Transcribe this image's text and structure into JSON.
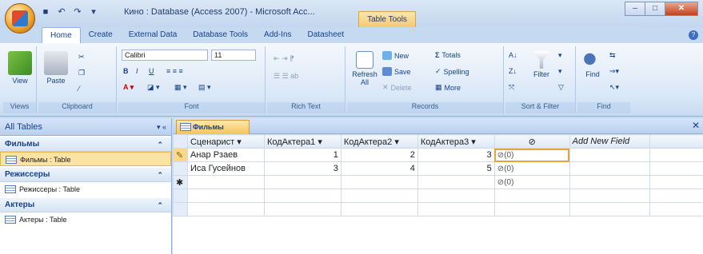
{
  "title_bar": {
    "window_title": "Кино : Database (Access 2007) - Microsoft Acc...",
    "context_tab": "Table Tools"
  },
  "tabs": [
    "Home",
    "Create",
    "External Data",
    "Database Tools",
    "Add-Ins",
    "Datasheet"
  ],
  "ribbon": {
    "views": {
      "view_label": "View",
      "group": "Views"
    },
    "clipboard": {
      "paste_label": "Paste",
      "group": "Clipboard"
    },
    "font": {
      "font_name": "Calibri",
      "font_size": "11",
      "group": "Font"
    },
    "rich_text": {
      "group": "Rich Text"
    },
    "records": {
      "refresh_label": "Refresh All",
      "new_label": "New",
      "save_label": "Save",
      "delete_label": "Delete",
      "totals_label": "Totals",
      "spelling_label": "Spelling",
      "more_label": "More",
      "group": "Records"
    },
    "sort_filter": {
      "filter_label": "Filter",
      "group": "Sort & Filter"
    },
    "find": {
      "find_label": "Find",
      "group": "Find"
    }
  },
  "nav_pane": {
    "header": "All Tables",
    "sections": [
      {
        "title": "Фильмы",
        "item": "Фильмы : Table"
      },
      {
        "title": "Режиссеры",
        "item": "Режиссеры : Table"
      },
      {
        "title": "Актеры",
        "item": "Актеры : Table"
      }
    ]
  },
  "document": {
    "tab_label": "Фильмы",
    "columns": [
      "Сценарист",
      "КодАктера1",
      "КодАктера2",
      "КодАктера3",
      "",
      "Add New Field"
    ],
    "rows": [
      {
        "writer": "Анар Рзаев",
        "a1": "1",
        "a2": "2",
        "a3": "3",
        "att": "(0)"
      },
      {
        "writer": "Иса Гусейнов",
        "a1": "3",
        "a2": "4",
        "a3": "5",
        "att": "(0)"
      },
      {
        "writer": "",
        "a1": "",
        "a2": "",
        "a3": "",
        "att": "(0)"
      }
    ]
  },
  "icons": [
    "office-button-icon",
    "save-icon",
    "undo-icon",
    "redo-icon",
    "help-icon",
    "table-icon",
    "paperclip-icon",
    "pencil-icon",
    "new-record-icon"
  ]
}
